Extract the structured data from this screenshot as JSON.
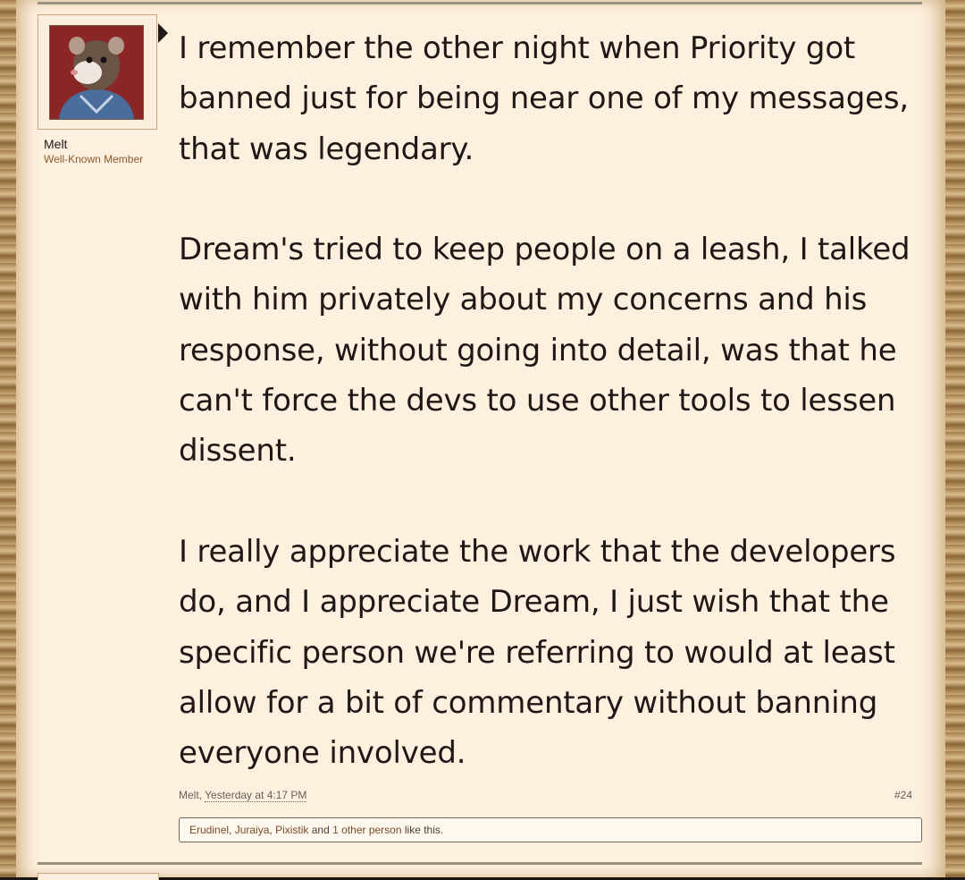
{
  "post": {
    "author": "Melt",
    "user_title": "Well-Known Member",
    "paragraphs": [
      "I remember the other night when Priority got banned just for being near one of my messages, that was legendary.",
      "Dream's tried to keep people on a leash, I talked with him privately about my concerns and his response, without going into detail, was that he can't force the devs to use other tools to lessen dissent.",
      "I really appreciate the work that the developers do, and I appreciate Dream, I just wish that the specific person we're referring to would at least allow for a bit of commentary without banning everyone involved."
    ],
    "meta_author": "Melt",
    "timestamp": "Yesterday at 4:17 PM",
    "post_number": "#24",
    "likes": {
      "users": [
        "Erudinel",
        "Juraiya",
        "Pixistik"
      ],
      "and_text": "and",
      "other_link": "1 other person",
      "suffix": "like this."
    }
  },
  "colors": {
    "parchment": "#fdf0df",
    "text": "#1f1816",
    "user_title": "#8b5a2b",
    "meta": "#6b5e55"
  },
  "icons": {
    "avatar": "rat-character-avatar",
    "arrow": "speech-pointer-arrow"
  }
}
